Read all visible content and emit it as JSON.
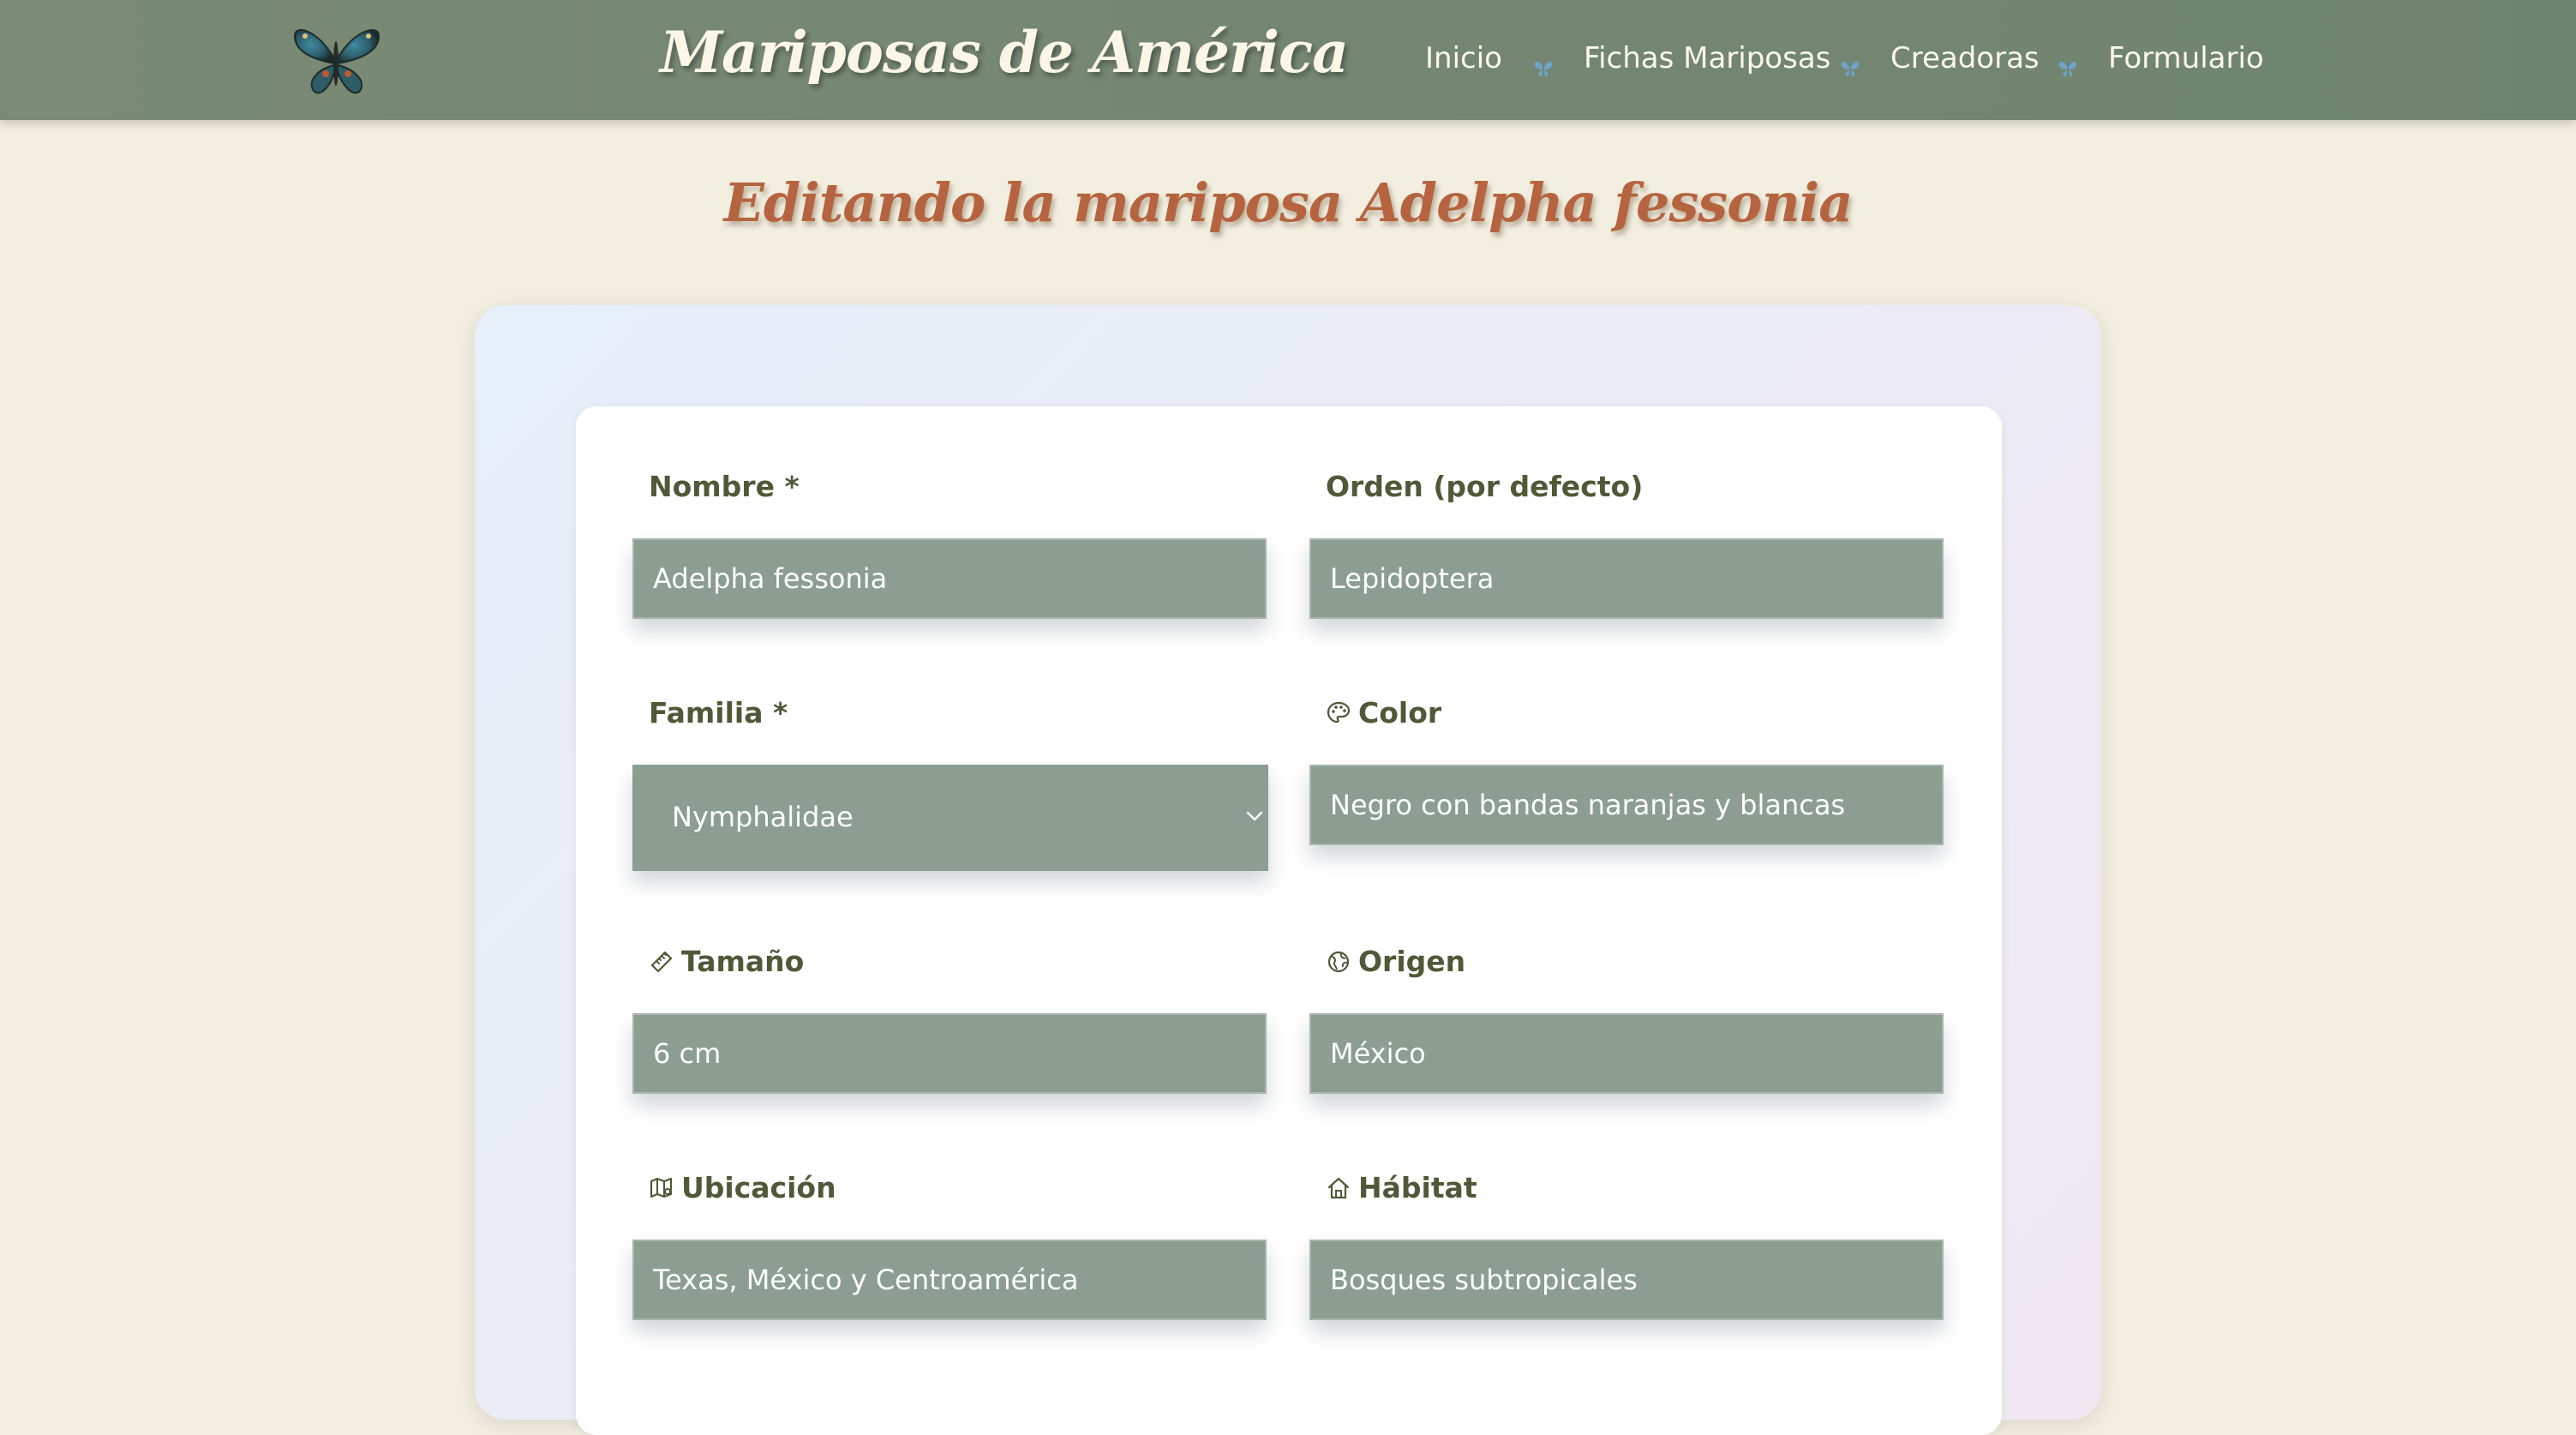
{
  "header": {
    "site_title": "Mariposas de América",
    "nav": [
      {
        "label": "Inicio"
      },
      {
        "label": "Fichas Mariposas"
      },
      {
        "label": "Creadoras"
      },
      {
        "label": "Formulario"
      }
    ]
  },
  "page": {
    "title_prefix": "Editando la mariposa",
    "species": "Adelpha fessonia"
  },
  "form": {
    "nombre": {
      "label": "Nombre *",
      "value": "Adelpha fessonia"
    },
    "orden": {
      "label": "Orden (por defecto)",
      "value": "Lepidoptera"
    },
    "familia": {
      "label": "Familia *",
      "selected": "Nymphalidae"
    },
    "color": {
      "label": "Color",
      "value": "Negro con bandas naranjas y blancas",
      "icon": "palette-icon"
    },
    "tamano": {
      "label": "Tamaño",
      "value": "6 cm",
      "icon": "ruler-icon"
    },
    "origen": {
      "label": "Origen",
      "value": "México",
      "icon": "globe-icon"
    },
    "ubicacion": {
      "label": "Ubicación",
      "value": "Texas, México y Centroamérica",
      "icon": "map-icon"
    },
    "habitat": {
      "label": "Hábitat",
      "value": "Bosques subtropicales",
      "icon": "home-icon"
    }
  },
  "colors": {
    "header_bg": "#728472",
    "title": "#b5643f",
    "label": "#4e5a37",
    "field_bg": "#8c9d92",
    "page_bg": "#f2efe1"
  }
}
